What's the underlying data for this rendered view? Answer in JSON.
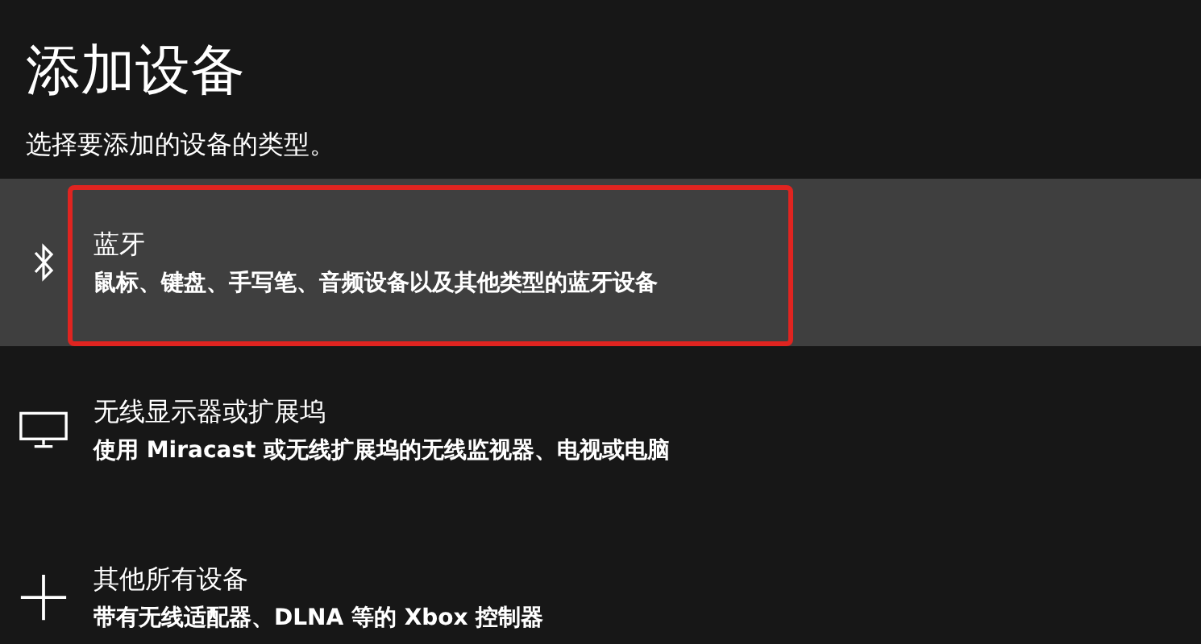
{
  "title": "添加设备",
  "subtitle": "选择要添加的设备的类型。",
  "items": [
    {
      "kind": "bluetooth",
      "title": "蓝牙",
      "description": "鼠标、键盘、手写笔、音频设备以及其他类型的蓝牙设备",
      "selected": true,
      "highlighted": true
    },
    {
      "kind": "display",
      "title": "无线显示器或扩展坞",
      "description": "使用 Miracast 或无线扩展坞的无线监视器、电视或电脑",
      "selected": false,
      "highlighted": false
    },
    {
      "kind": "plus",
      "title": "其他所有设备",
      "description": "带有无线适配器、DLNA 等的 Xbox 控制器",
      "selected": false,
      "highlighted": false
    }
  ]
}
